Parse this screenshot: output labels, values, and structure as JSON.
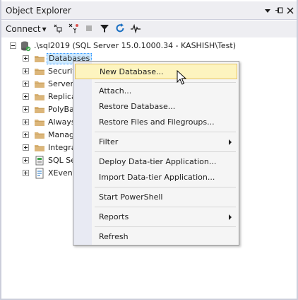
{
  "panel": {
    "title": "Object Explorer",
    "pin_glyph": "▾",
    "dock_glyph": "⊣",
    "close_glyph": "×"
  },
  "toolbar": {
    "connect_label": "Connect",
    "caret": "▾",
    "icons": [
      "connect-icon",
      "disconnect-icon",
      "stop-icon",
      "filter-icon",
      "refresh-icon",
      "activity-monitor-icon"
    ]
  },
  "tree": {
    "server": {
      "label": ".\\sql2019 (SQL Server 15.0.1000.34 - KASHISH\\Test)"
    },
    "nodes": [
      {
        "label": "Databases",
        "icon": "folder-icon",
        "selected": true
      },
      {
        "label": "Securit",
        "icon": "folder-icon"
      },
      {
        "label": "Server",
        "icon": "folder-icon"
      },
      {
        "label": "Replica",
        "icon": "folder-icon"
      },
      {
        "label": "PolyBa",
        "icon": "folder-icon"
      },
      {
        "label": "Always",
        "icon": "folder-icon"
      },
      {
        "label": "Manag",
        "icon": "folder-icon"
      },
      {
        "label": "Integra",
        "icon": "folder-icon"
      },
      {
        "label": "SQL Se",
        "icon": "sql-agent-icon"
      },
      {
        "label": "XEvent",
        "icon": "xevent-icon"
      }
    ]
  },
  "context_menu": {
    "items": [
      {
        "label": "New Database...",
        "highlighted": true
      },
      {
        "label": "Attach..."
      },
      {
        "label": "Restore Database..."
      },
      {
        "label": "Restore Files and Filegroups..."
      },
      {
        "label": "Filter",
        "submenu": true
      },
      {
        "label": "Deploy Data-tier Application..."
      },
      {
        "label": "Import Data-tier Application..."
      },
      {
        "label": "Start PowerShell"
      },
      {
        "label": "Reports",
        "submenu": true
      },
      {
        "label": "Refresh"
      }
    ]
  },
  "colors": {
    "accent_highlight": "#fdf4bf",
    "selection": "#cce8ff",
    "folder": "#dcb67a"
  }
}
